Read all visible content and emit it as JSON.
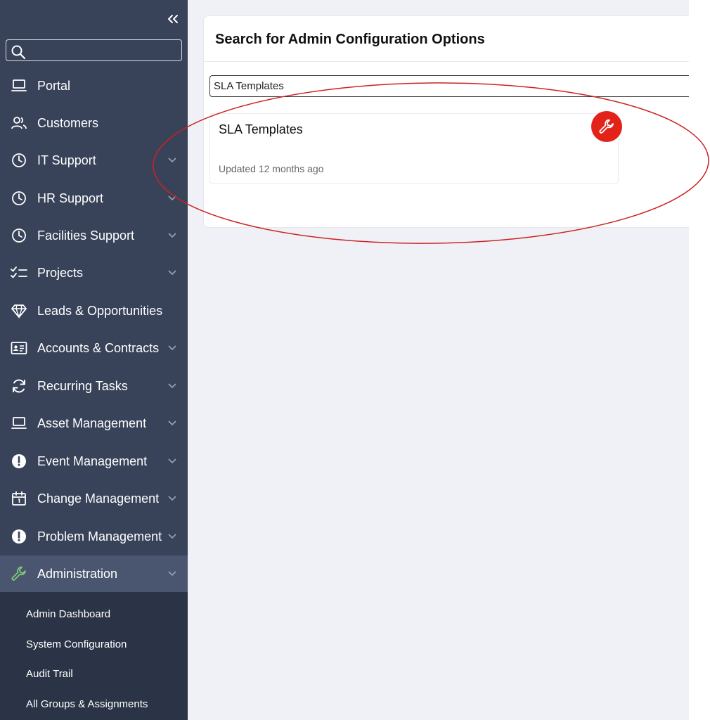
{
  "sidebar": {
    "search": {
      "placeholder": ""
    },
    "items": [
      {
        "label": "Portal"
      },
      {
        "label": "Customers"
      },
      {
        "label": "IT Support"
      },
      {
        "label": "HR Support"
      },
      {
        "label": "Facilities Support"
      },
      {
        "label": "Projects"
      },
      {
        "label": "Leads & Opportunities"
      },
      {
        "label": "Accounts & Contracts"
      },
      {
        "label": "Recurring Tasks"
      },
      {
        "label": "Asset Management"
      },
      {
        "label": "Event Management"
      },
      {
        "label": "Change Management"
      },
      {
        "label": "Problem Management"
      },
      {
        "label": "Administration"
      }
    ],
    "admin_submenu": [
      {
        "label": "Admin Dashboard"
      },
      {
        "label": "System Configuration"
      },
      {
        "label": "Audit Trail"
      },
      {
        "label": "All Groups & Assignments"
      }
    ]
  },
  "main": {
    "panel_title": "Search for Admin Configuration Options",
    "search_value": "SLA Templates",
    "results": [
      {
        "title": "SLA Templates",
        "updated": "Updated 12 months ago"
      }
    ]
  },
  "colors": {
    "sidebar_bg": "#384359",
    "sidebar_active": "#4a5570",
    "submenu_bg": "#2b3446",
    "main_bg": "#eff1f6",
    "badge_red": "#e2231a",
    "annotation_red": "#cc2222",
    "admin_icon_green": "#7dc87a"
  }
}
